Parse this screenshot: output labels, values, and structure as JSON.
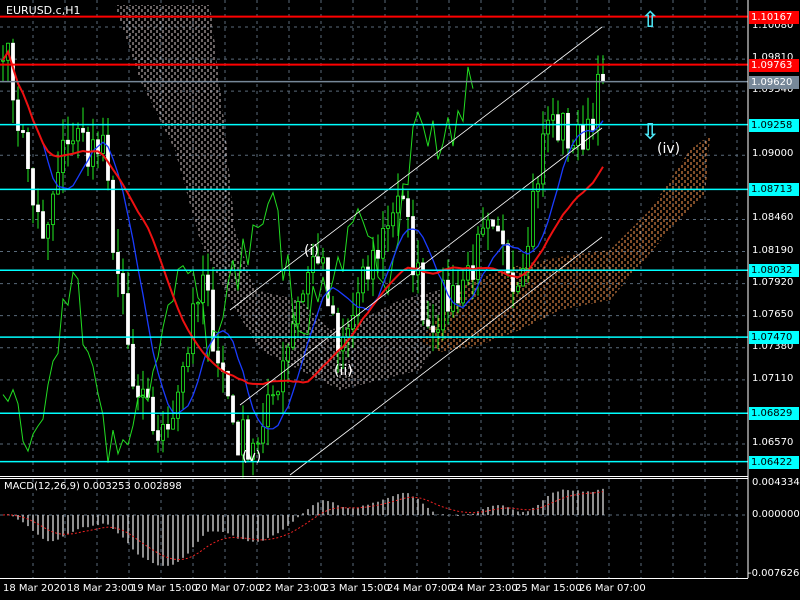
{
  "title": "EURUSD.c,H1",
  "macd_label": "MACD(12,26,9) 0.003253 0.002898",
  "price_axis": [
    "1.10080",
    "1.09810",
    "1.09540",
    "1.09000",
    "1.08460",
    "1.08190",
    "1.07920",
    "1.07650",
    "1.07380",
    "1.07110",
    "1.06570"
  ],
  "macd_axis": [
    "0.004334",
    "0.000000",
    "-0.007626"
  ],
  "levels": [
    {
      "price": "1.10167",
      "color": "#ff0000",
      "text": "#ffffff"
    },
    {
      "price": "1.09763",
      "color": "#ff0000",
      "text": "#ffffff"
    },
    {
      "price": "1.09620",
      "color": "#778899",
      "text": "#ffffff"
    },
    {
      "price": "1.09258",
      "color": "#00ffff",
      "text": "#000000"
    },
    {
      "price": "1.08713",
      "color": "#00ffff",
      "text": "#000000"
    },
    {
      "price": "1.08032",
      "color": "#00ffff",
      "text": "#000000"
    },
    {
      "price": "1.07470",
      "color": "#00ffff",
      "text": "#000000"
    },
    {
      "price": "1.06829",
      "color": "#00ffff",
      "text": "#000000"
    },
    {
      "price": "1.06422",
      "color": "#00ffff",
      "text": "#000000"
    }
  ],
  "time_axis": [
    "18 Mar 2020",
    "18 Mar 23:00",
    "19 Mar 15:00",
    "20 Mar 07:00",
    "22 Mar 23:00",
    "23 Mar 15:00",
    "24 Mar 07:00",
    "24 Mar 23:00",
    "25 Mar 15:00",
    "26 Mar 07:00"
  ],
  "wave_labels": {
    "i": "(i)",
    "ii": "(ii)",
    "iv": "(iv)",
    "v": "(v)"
  },
  "chart_data": {
    "type": "candlestick",
    "symbol": "EURUSD.c",
    "timeframe": "H1",
    "ylim": [
      1.0618,
      1.1038
    ],
    "macd_ylim": [
      -0.007626,
      0.004334
    ],
    "key_closes": [
      [
        0,
        1.1
      ],
      [
        8,
        1.082
      ],
      [
        13,
        1.092
      ],
      [
        20,
        1.09
      ],
      [
        26,
        1.07
      ],
      [
        32,
        1.066
      ],
      [
        40,
        1.079
      ],
      [
        47,
        1.066
      ],
      [
        52,
        1.0665
      ],
      [
        59,
        1.078
      ],
      [
        63,
        1.082
      ],
      [
        67,
        1.073
      ],
      [
        73,
        1.08
      ],
      [
        79,
        1.087
      ],
      [
        85,
        1.076
      ],
      [
        91,
        1.079
      ],
      [
        97,
        1.083
      ],
      [
        103,
        1.08
      ],
      [
        109,
        1.093
      ],
      [
        115,
        1.091
      ],
      [
        120,
        1.0962
      ]
    ]
  }
}
